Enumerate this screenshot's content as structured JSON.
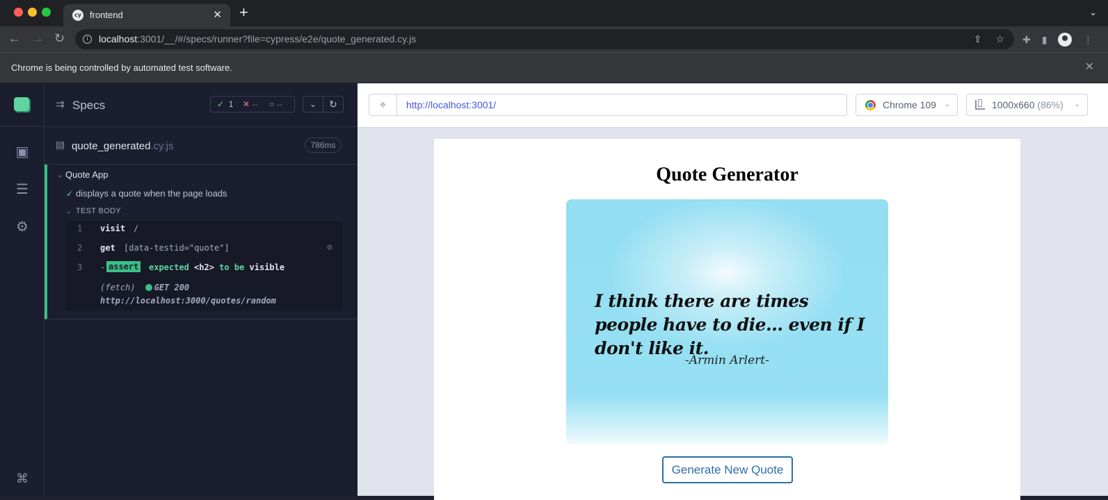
{
  "browser": {
    "tab_title": "frontend",
    "tab_favicon": "cy",
    "url_host": "localhost",
    "url_rest": ":3001/__/#/specs/runner?file=cypress/e2e/quote_generated.cy.js",
    "infobar_text": "Chrome is being controlled by automated test software."
  },
  "reporter": {
    "title": "Specs",
    "stats": {
      "passed": "1",
      "failed": "--",
      "pending": "--"
    },
    "spec": {
      "name": "quote_generated",
      "ext": ".cy.js",
      "duration": "786ms"
    },
    "suite_title": "Quote App",
    "test_title": "displays a quote when the page loads",
    "test_body_label": "TEST BODY",
    "commands": [
      {
        "num": "1",
        "name": "visit",
        "message": "/"
      },
      {
        "num": "2",
        "name": "get",
        "message": "[data-testid=\"quote\"]"
      },
      {
        "num": "3",
        "name": "assert",
        "prefix": "-",
        "msg_expected": "expected",
        "msg_subject": "<h2>",
        "msg_to_be": "to be",
        "msg_state": "visible"
      }
    ],
    "fetch": {
      "label": "(fetch)",
      "status": "GET 200",
      "url": "http://localhost:3000/quotes/random"
    }
  },
  "aut": {
    "url": "http://localhost:3001/",
    "browser_label": "Chrome 109",
    "viewport_size": "1000x660",
    "viewport_scale": "(86%)"
  },
  "app": {
    "title": "Quote Generator",
    "quote": "I think there are times people have to die… even if I don't like it.",
    "author": "-Armin Arlert-",
    "button_label": "Generate New Quote"
  },
  "colors": {
    "cypress_accent": "#3bbf85",
    "link_purple": "#4956e3",
    "button_blue": "#2a6fae"
  }
}
